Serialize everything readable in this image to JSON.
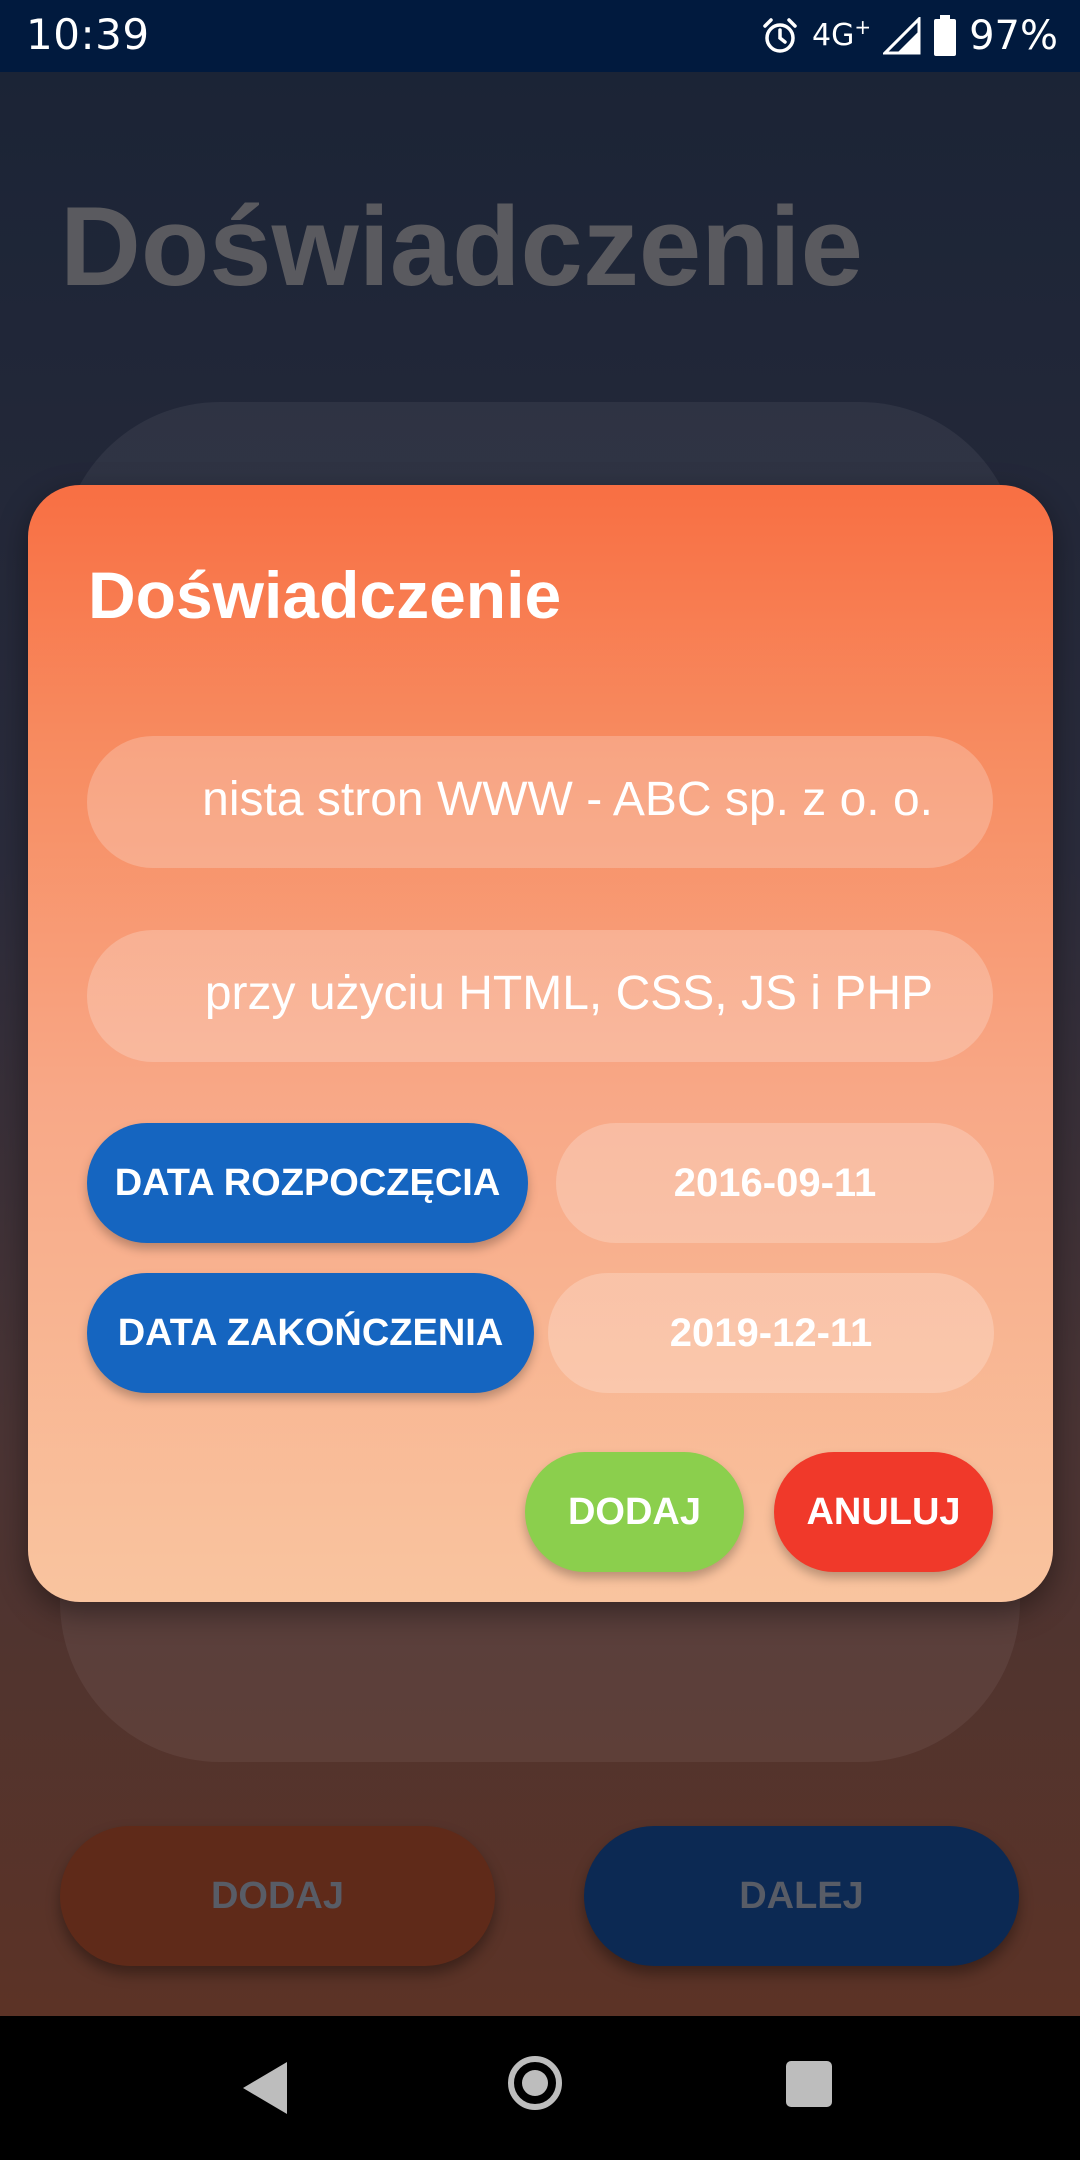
{
  "status_bar": {
    "time": "10:39",
    "network": "4G",
    "network_plus": "+",
    "battery": "97%",
    "icons": [
      "alarm-icon",
      "signal-icon",
      "battery-icon"
    ]
  },
  "background": {
    "title": "Doświadczenie",
    "add_button": "DODAJ",
    "next_button": "DALEJ"
  },
  "dialog": {
    "title": "Doświadczenie",
    "position_field": "nista stron WWW - ABC sp. z o. o.",
    "description_field": "przy użyciu HTML, CSS, JS i PHP",
    "start_date_button": "DATA ROZPOCZĘCIA",
    "start_date_value": "2016-09-11",
    "end_date_button": "DATA ZAKOŃCZENIA",
    "end_date_value": "2019-12-11",
    "add_button": "DODAJ",
    "cancel_button": "ANULUJ"
  },
  "colors": {
    "status_bar": "#011a3e",
    "dialog_top": "#f86f43",
    "dialog_bottom": "#f9c49f",
    "date_button": "#1565c0",
    "add": "#8bcf4d",
    "cancel": "#f0392a"
  },
  "nav_bar": {
    "icons": [
      "back-icon",
      "home-icon",
      "recents-icon"
    ]
  }
}
